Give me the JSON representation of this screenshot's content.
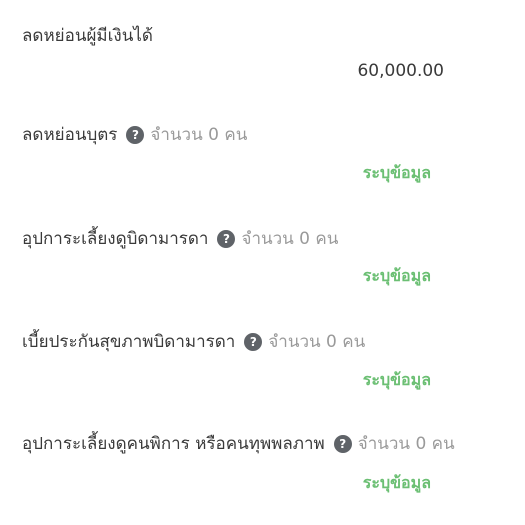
{
  "rows": [
    {
      "label": "ลดหย่อนผู้มีเงินได้",
      "value": "60,000.00"
    },
    {
      "label": "ลดหย่อนบุตร",
      "count_text": "จำนวน 0 คน",
      "action": "ระบุข้อมูล"
    },
    {
      "label": "อุปการะเลี้ยงดูบิดามารดา",
      "count_text": "จำนวน 0 คน",
      "action": "ระบุข้อมูล"
    },
    {
      "label": "เบี้ยประกันสุขภาพบิดามารดา",
      "count_text": "จำนวน 0 คน",
      "action": "ระบุข้อมูล"
    },
    {
      "label": "อุปการะเลี้ยงดูคนพิการ หรือคนทุพพลภาพ",
      "count_text": "จำนวน 0 คน",
      "action": "ระบุข้อมูล"
    }
  ],
  "help_glyph": "?",
  "colors": {
    "text": "#3a3a3a",
    "muted": "#9a9a9a",
    "icon": "#5f6368",
    "action": "#6bbf73"
  }
}
